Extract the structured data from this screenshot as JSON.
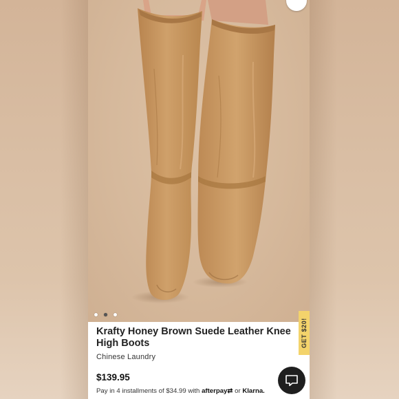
{
  "product": {
    "title": "Krafty Honey Brown Suede Leather Knee High Boots",
    "designer": "Chinese Laundry",
    "price": "$139.95",
    "installments": {
      "prefix": "Pay in 4 installments of $34.99 with",
      "afterpay": "afterpay",
      "or": "or",
      "klarna": "Klarna."
    }
  },
  "gallery": {
    "image_count": 3,
    "active_index": 1
  },
  "promo": {
    "label": "GET $20!"
  },
  "icons": {
    "brand": "brand-logo-icon",
    "chat": "chat-icon"
  },
  "colors": {
    "suede": "#c99a64",
    "background": "#d8bca0",
    "promo": "#f3d36b",
    "chat": "#1f1f1f"
  }
}
